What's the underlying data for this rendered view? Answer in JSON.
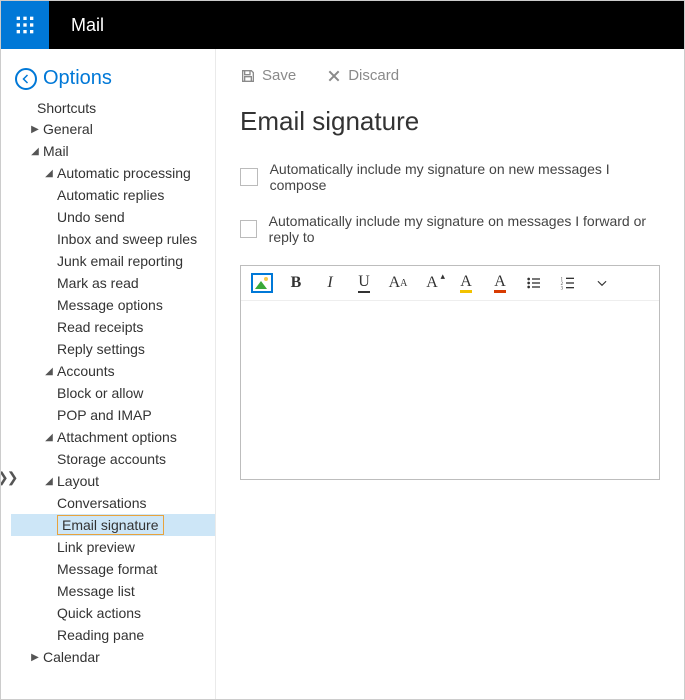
{
  "header": {
    "app_title": "Mail"
  },
  "options": {
    "title": "Options",
    "shortcuts_label": "Shortcuts",
    "tree": {
      "general": "General",
      "mail": "Mail",
      "auto_processing": "Automatic processing",
      "auto_replies": "Automatic replies",
      "undo_send": "Undo send",
      "inbox_sweep": "Inbox and sweep rules",
      "junk_report": "Junk email reporting",
      "mark_read": "Mark as read",
      "msg_options": "Message options",
      "read_receipts": "Read receipts",
      "reply_settings": "Reply settings",
      "accounts": "Accounts",
      "block_allow": "Block or allow",
      "pop_imap": "POP and IMAP",
      "attach_opts": "Attachment options",
      "storage_accounts": "Storage accounts",
      "layout": "Layout",
      "conversations": "Conversations",
      "email_signature": "Email signature",
      "link_preview": "Link preview",
      "message_format": "Message format",
      "message_list": "Message list",
      "quick_actions": "Quick actions",
      "reading_pane": "Reading pane",
      "calendar": "Calendar"
    }
  },
  "main": {
    "save_label": "Save",
    "discard_label": "Discard",
    "page_title": "Email signature",
    "check1": "Automatically include my signature on new messages I compose",
    "check2": "Automatically include my signature on messages I forward or reply to"
  },
  "toolbar": {
    "bold": "B",
    "italic": "I",
    "underline": "U",
    "font_size": "A",
    "highlight": "A",
    "font_color": "A"
  }
}
